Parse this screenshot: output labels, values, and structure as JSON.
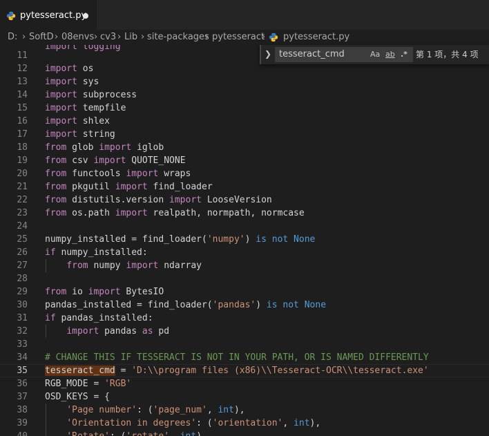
{
  "tab": {
    "title": "pytesseract.py"
  },
  "breadcrumb": {
    "items": [
      "D:",
      "SoftD",
      "08envs",
      "cv3",
      "Lib",
      "site-packages",
      "pytesseract",
      "pytesseract.py"
    ]
  },
  "find": {
    "query": "tesseract_cmd",
    "match_case_label": "Aa",
    "whole_word_label": "ab",
    "regex_label": ".*",
    "result": "第 1 项，共 4 项"
  },
  "editor": {
    "top_partial": "import logging",
    "current_line": "35",
    "lines": [
      {
        "n": "11",
        "t": []
      },
      {
        "n": "12",
        "t": [
          [
            "import",
            "kw"
          ],
          [
            " os",
            "pl"
          ]
        ]
      },
      {
        "n": "13",
        "t": [
          [
            "import",
            "kw"
          ],
          [
            " sys",
            "pl"
          ]
        ]
      },
      {
        "n": "14",
        "t": [
          [
            "import",
            "kw"
          ],
          [
            " subprocess",
            "pl"
          ]
        ]
      },
      {
        "n": "15",
        "t": [
          [
            "import",
            "kw"
          ],
          [
            " tempfile",
            "pl"
          ]
        ]
      },
      {
        "n": "16",
        "t": [
          [
            "import",
            "kw"
          ],
          [
            " shlex",
            "pl"
          ]
        ]
      },
      {
        "n": "17",
        "t": [
          [
            "import",
            "kw"
          ],
          [
            " string",
            "pl"
          ]
        ]
      },
      {
        "n": "18",
        "t": [
          [
            "from",
            "kw"
          ],
          [
            " glob ",
            "pl"
          ],
          [
            "import",
            "kw"
          ],
          [
            " iglob",
            "pl"
          ]
        ]
      },
      {
        "n": "19",
        "t": [
          [
            "from",
            "kw"
          ],
          [
            " csv ",
            "pl"
          ],
          [
            "import",
            "kw"
          ],
          [
            " QUOTE_NONE",
            "pl"
          ]
        ]
      },
      {
        "n": "20",
        "t": [
          [
            "from",
            "kw"
          ],
          [
            " functools ",
            "pl"
          ],
          [
            "import",
            "kw"
          ],
          [
            " wraps",
            "pl"
          ]
        ]
      },
      {
        "n": "21",
        "t": [
          [
            "from",
            "kw"
          ],
          [
            " pkgutil ",
            "pl"
          ],
          [
            "import",
            "kw"
          ],
          [
            " find_loader",
            "pl"
          ]
        ]
      },
      {
        "n": "22",
        "t": [
          [
            "from",
            "kw"
          ],
          [
            " distutils.version ",
            "pl"
          ],
          [
            "import",
            "kw"
          ],
          [
            " LooseVersion",
            "pl"
          ]
        ]
      },
      {
        "n": "23",
        "t": [
          [
            "from",
            "kw"
          ],
          [
            " os.path ",
            "pl"
          ],
          [
            "import",
            "kw"
          ],
          [
            " realpath, normpath, normcase",
            "pl"
          ]
        ]
      },
      {
        "n": "24",
        "t": []
      },
      {
        "n": "25",
        "t": [
          [
            "numpy_installed = find_loader(",
            "pl"
          ],
          [
            "'numpy'",
            "str"
          ],
          [
            ") ",
            "pl"
          ],
          [
            "is not None",
            "kb"
          ]
        ]
      },
      {
        "n": "26",
        "t": [
          [
            "if",
            "kw"
          ],
          [
            " numpy_installed:",
            "pl"
          ]
        ]
      },
      {
        "n": "27",
        "t": [
          [
            "    ",
            "pl"
          ],
          [
            "from",
            "kw"
          ],
          [
            " numpy ",
            "pl"
          ],
          [
            "import",
            "kw"
          ],
          [
            " ndarray",
            "pl"
          ]
        ]
      },
      {
        "n": "28",
        "t": []
      },
      {
        "n": "29",
        "t": [
          [
            "from",
            "kw"
          ],
          [
            " io ",
            "pl"
          ],
          [
            "import",
            "kw"
          ],
          [
            " BytesIO",
            "pl"
          ]
        ]
      },
      {
        "n": "30",
        "t": [
          [
            "pandas_installed = find_loader(",
            "pl"
          ],
          [
            "'pandas'",
            "str"
          ],
          [
            ") ",
            "pl"
          ],
          [
            "is not None",
            "kb"
          ]
        ]
      },
      {
        "n": "31",
        "t": [
          [
            "if",
            "kw"
          ],
          [
            " pandas_installed:",
            "pl"
          ]
        ]
      },
      {
        "n": "32",
        "t": [
          [
            "    ",
            "pl"
          ],
          [
            "import",
            "kw"
          ],
          [
            " pandas ",
            "pl"
          ],
          [
            "as",
            "kw"
          ],
          [
            " pd",
            "pl"
          ]
        ]
      },
      {
        "n": "33",
        "t": []
      },
      {
        "n": "34",
        "t": [
          [
            "# CHANGE THIS IF TESSERACT IS NOT IN YOUR PATH, OR IS NAMED DIFFERENTLY",
            "cmt"
          ]
        ]
      },
      {
        "n": "35",
        "t": [
          [
            "tesseract_cmd",
            "match"
          ],
          [
            " = ",
            "pl"
          ],
          [
            "'D:\\\\program files (x86)\\\\Tesseract-OCR\\\\tesseract.exe'",
            "str"
          ]
        ]
      },
      {
        "n": "36",
        "t": [
          [
            "RGB_MODE = ",
            "pl"
          ],
          [
            "'RGB'",
            "str"
          ]
        ]
      },
      {
        "n": "37",
        "t": [
          [
            "OSD_KEYS = {",
            "pl"
          ]
        ]
      },
      {
        "n": "38",
        "t": [
          [
            "    ",
            "pl"
          ],
          [
            "'Page number'",
            "str"
          ],
          [
            ": (",
            "pl"
          ],
          [
            "'page_num'",
            "str"
          ],
          [
            ", ",
            "pl"
          ],
          [
            "int",
            "kb"
          ],
          [
            "),",
            "pl"
          ]
        ]
      },
      {
        "n": "39",
        "t": [
          [
            "    ",
            "pl"
          ],
          [
            "'Orientation in degrees'",
            "str"
          ],
          [
            ": (",
            "pl"
          ],
          [
            "'orientation'",
            "str"
          ],
          [
            ", ",
            "pl"
          ],
          [
            "int",
            "kb"
          ],
          [
            "),",
            "pl"
          ]
        ]
      },
      {
        "n": "40",
        "t": [
          [
            "    ",
            "pl"
          ],
          [
            "'Rotate'",
            "str"
          ],
          [
            ": (",
            "pl"
          ],
          [
            "'rotate'",
            "str"
          ],
          [
            ", ",
            "pl"
          ],
          [
            "int",
            "kb"
          ],
          [
            "),",
            "pl"
          ]
        ]
      }
    ]
  }
}
